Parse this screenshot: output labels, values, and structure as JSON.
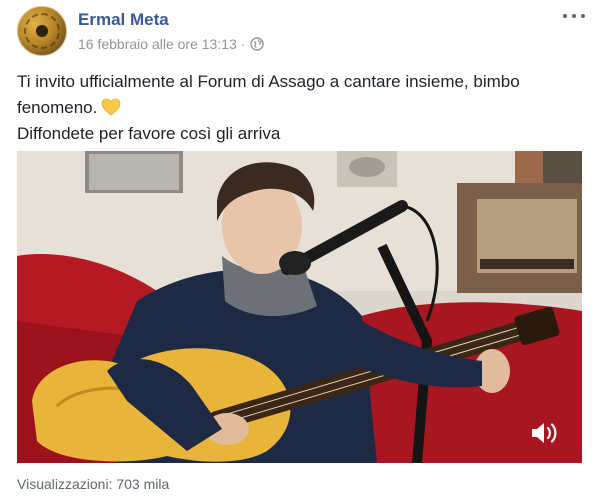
{
  "post": {
    "author": "Ermal Meta",
    "timestamp": "16 febbraio alle ore 13:13",
    "separator": "·",
    "privacy_icon": "globe-icon",
    "more_icon": "more-dots-icon",
    "text_line_1": "Ti invito ufficialmente al Forum di Assago a cantare insieme, bimbo fenomeno.",
    "text_emoji": "yellow-heart-icon",
    "text_line_2": "Diffondete per favore così gli arriva"
  },
  "video": {
    "sound_icon": "speaker-icon"
  },
  "footer": {
    "views": "Visualizzazioni: 703 mila"
  },
  "colors": {
    "author_link": "#385898",
    "meta_gray": "#90949c",
    "heart": "#f7c948"
  }
}
